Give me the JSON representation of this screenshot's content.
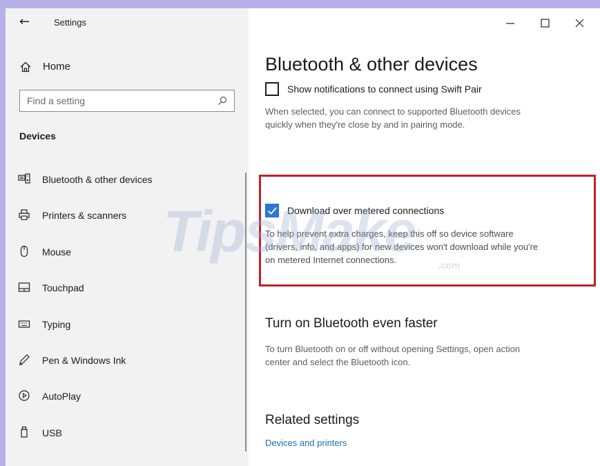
{
  "window": {
    "title": "Settings",
    "controls": {
      "minimize": "minimize-icon",
      "maximize": "maximize-icon",
      "close": "close-icon"
    }
  },
  "sidebar": {
    "home_label": "Home",
    "search_placeholder": "Find a setting",
    "section_title": "Devices",
    "items": [
      {
        "label": "Bluetooth & other devices",
        "icon": "bluetooth-devices-icon"
      },
      {
        "label": "Printers & scanners",
        "icon": "printer-icon"
      },
      {
        "label": "Mouse",
        "icon": "mouse-icon"
      },
      {
        "label": "Touchpad",
        "icon": "touchpad-icon"
      },
      {
        "label": "Typing",
        "icon": "keyboard-icon"
      },
      {
        "label": "Pen & Windows Ink",
        "icon": "pen-icon"
      },
      {
        "label": "AutoPlay",
        "icon": "autoplay-icon"
      },
      {
        "label": "USB",
        "icon": "usb-icon"
      }
    ]
  },
  "main": {
    "title": "Bluetooth & other devices",
    "swift_pair": {
      "label": "Show notifications to connect using Swift Pair",
      "checked": false,
      "description_line1": "When selected, you can connect to supported Bluetooth devices",
      "description_line2": "quickly when they're close by and in pairing mode."
    },
    "metered": {
      "label": "Download over metered connections",
      "checked": true,
      "description_line1": "To help prevent extra charges, keep this off so device software",
      "description_line2": "(drivers, info, and apps) for new devices won't download while you're",
      "description_line3": "on metered Internet connections."
    },
    "faster": {
      "heading": "Turn on Bluetooth even faster",
      "description_line1": "To turn Bluetooth on or off without opening Settings, open action",
      "description_line2": "center and select the Bluetooth icon."
    },
    "related": {
      "heading": "Related settings",
      "link": "Devices and printers"
    }
  },
  "watermark": {
    "text": "TipsMake",
    "suffix": ".com"
  },
  "colors": {
    "accent": "#2a78d4",
    "highlight_border": "#c0202b",
    "link": "#1f6fb4",
    "sidebar_bg": "#f2f2f2"
  }
}
